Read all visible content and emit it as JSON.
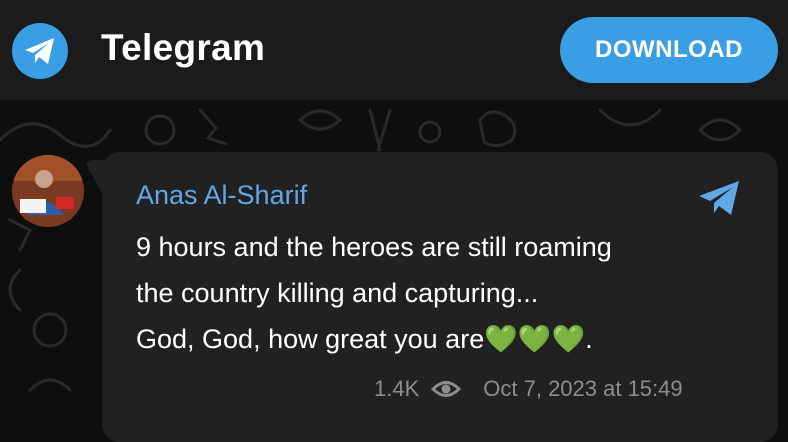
{
  "header": {
    "app_name": "Telegram",
    "download_label": "DOWNLOAD",
    "logo_icon": "telegram-paper-plane-icon"
  },
  "message": {
    "sender": "Anas Al-Sharif",
    "lines": [
      "9 hours and the heroes are still roaming",
      "the country killing and capturing...",
      "God, God, how great you are"
    ],
    "emoji": "💚💚💚",
    "trailing": ".",
    "views": "1.4K",
    "timestamp": "Oct 7, 2023 at 15:49"
  },
  "colors": {
    "accent": "#3a9ee4",
    "sender_name": "#62a8e6",
    "bubble_bg": "#212121",
    "header_bg": "#1b1b1b",
    "heart": "#2fca37",
    "meta_text": "#8d8d8d"
  },
  "icons": [
    "telegram-logo-icon",
    "share-icon",
    "eye-icon"
  ]
}
